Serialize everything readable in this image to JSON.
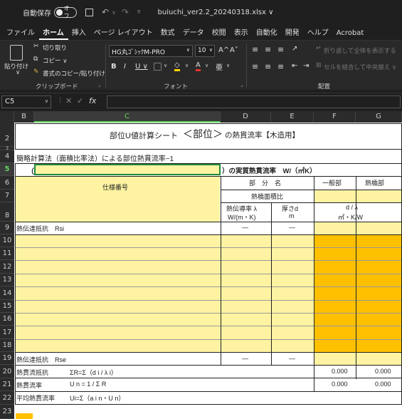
{
  "titlebar": {
    "autosave_label": "自動保存",
    "autosave_state": "オフ",
    "filename": "buiuchi_ver2.2_20240318.xlsx ∨"
  },
  "menu": [
    "ファイル",
    "ホーム",
    "挿入",
    "ページ レイアウト",
    "数式",
    "データ",
    "校閲",
    "表示",
    "自動化",
    "開発",
    "ヘルプ",
    "Acrobat"
  ],
  "ribbon": {
    "paste": "貼り付け",
    "cut": "切り取り",
    "copy": "コピー ∨",
    "format_painter": "書式のコピー/貼り付け",
    "clipboard_label": "クリップボード",
    "font_name": "HG丸ｺﾞｼｯｸM-PRO",
    "font_size": "10",
    "font_label": "フォント",
    "wrap_text": "折り返して全体を表示する",
    "merge_center": "セルを結合して中央揃え ∨",
    "align_label": "配置",
    "bold": "B",
    "italic": "I",
    "underline": "U ∨",
    "grow": "A^",
    "shrink": "A˅"
  },
  "formula": {
    "name_box": "C5",
    "fx": "fx"
  },
  "columns": [
    "B",
    "C",
    "D",
    "E",
    "F",
    "G"
  ],
  "rows": [
    "2",
    "3",
    "4",
    "5",
    "6",
    "7",
    "8",
    "9",
    "10",
    "11",
    "12",
    "13",
    "14",
    "15",
    "16",
    "17",
    "18",
    "19",
    "20",
    "21",
    "22",
    "23"
  ],
  "sheet": {
    "title_pre": "部位U値計算シート",
    "title_mid": "＜部位＞",
    "title_post": "の熱貫流率【木造用】",
    "subtitle": "簡略計算法（面積比率法）による部位熱貫流率−1",
    "row5_open": "（",
    "row5_label": "）の実質熱貫流率　W/（㎡K）",
    "spec_no": "仕様番号",
    "bubun": "部　分　名",
    "ippanbu": "一般部",
    "netsukyobu": "熱橋部",
    "area_ratio": "熱橋面積比",
    "lambda_hdr": "熱伝導率 λ",
    "lambda_unit": "W/(m・K)",
    "thick_hdr": "厚さd",
    "thick_unit": "m",
    "dl_hdr": "d / λ",
    "dl_unit": "㎡・K/W",
    "rsi": "熱伝達抵抗　Rsi",
    "rse": "熱伝達抵抗　Rse",
    "dash": "—",
    "r_sum_label": "熱貫流抵抗",
    "r_sum_formula": "ΣR=Σ（d i / λ i）",
    "u_label": "熱貫流率",
    "u_formula": "U n = 1 / Σ R",
    "avg_label": "平均熱貫流率",
    "avg_formula": "Ui=Σ（a i n・U n）",
    "r_sum_f": "0.000",
    "r_sum_g": "0.000",
    "u_f": "0.000",
    "u_g": "0.000"
  }
}
